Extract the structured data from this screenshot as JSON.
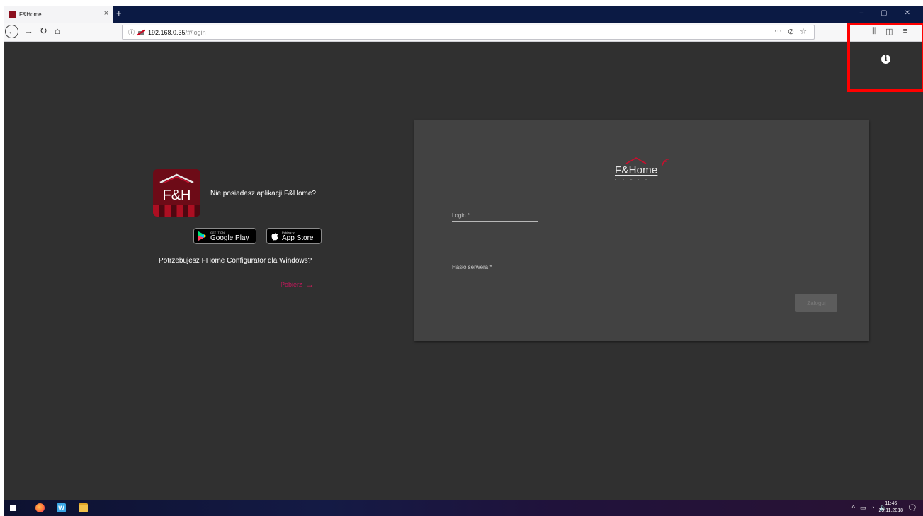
{
  "browser": {
    "tab_title": "F&Home",
    "tab_close": "×",
    "new_tab": "+",
    "window_controls": [
      "–",
      "▢",
      "✕"
    ],
    "url_host": "192.168.0.35",
    "url_path": "/#/login",
    "url_info_icon": "ⓘ",
    "url_more": "···",
    "pocket_icon": "⊘",
    "bookmark_star": "☆",
    "library_icon": "⫼",
    "sidebar_icon": "◫",
    "menu_icon": "≡",
    "back": "←",
    "forward": "→",
    "reload": "↻",
    "home": "⌂"
  },
  "page": {
    "info_icon": "i",
    "promo": {
      "logo_text": "F&H",
      "no_app_text": "Nie posiadasz aplikacji F&Home?",
      "google_play_small": "GET IT ON",
      "google_play_big": "Google Play",
      "app_store_small": "Pobierz w",
      "app_store_big": "App Store",
      "need_configurator_text": "Potrzebujesz FHome Configurator dla Windows?",
      "download_label": "Pobierz",
      "download_arrow": "→"
    },
    "login_card": {
      "brand": "F&Home",
      "brand_sub": "RADIO",
      "login_label": "Login *",
      "password_label": "Hasło serwera *",
      "submit_label": "Zaloguj"
    },
    "colors": {
      "background": "#303030",
      "card": "#424242",
      "accent": "#e91e63",
      "highlight": "#ff0000"
    }
  },
  "taskbar": {
    "word_app": "W",
    "tray_icons": [
      "^",
      "▭",
      "◔",
      "🔈"
    ],
    "time": "11:46",
    "date": "29.11.2018",
    "notification_icon": "🗨"
  }
}
